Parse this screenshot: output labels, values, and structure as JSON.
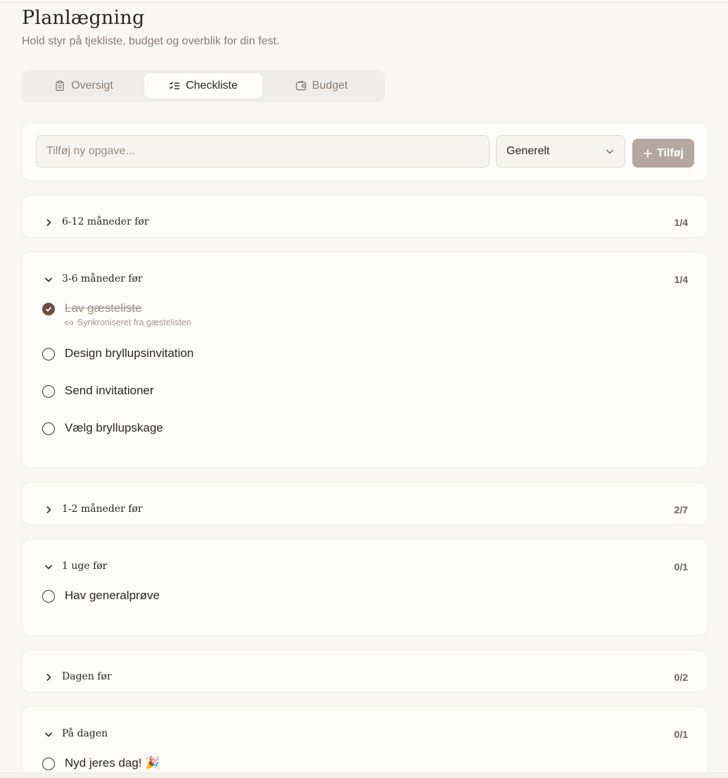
{
  "header": {
    "title": "Planlægning",
    "subtitle": "Hold styr på tjekliste, budget og overblik for din fest."
  },
  "tabs": [
    {
      "label": "Oversigt",
      "icon": "clipboard-icon",
      "active": false
    },
    {
      "label": "Checkliste",
      "icon": "checklist-icon",
      "active": true
    },
    {
      "label": "Budget",
      "icon": "wallet-icon",
      "active": false
    }
  ],
  "add_task": {
    "placeholder": "Tilføj ny opgave...",
    "category_selected": "Generelt",
    "button_label": "Tilføj"
  },
  "sections": [
    {
      "title": "6-12 måneder før",
      "count": "1/4",
      "expanded": false,
      "tasks": []
    },
    {
      "title": "3-6 måneder før",
      "count": "1/4",
      "expanded": true,
      "tasks": [
        {
          "label": "Lav gæsteliste",
          "done": true,
          "note": "Synkroniseret fra gæstelisten"
        },
        {
          "label": "Design bryllupsinvitation",
          "done": false
        },
        {
          "label": "Send invitationer",
          "done": false
        },
        {
          "label": "Vælg bryllupskage",
          "done": false
        }
      ]
    },
    {
      "title": "1-2 måneder før",
      "count": "2/7",
      "expanded": false,
      "tasks": []
    },
    {
      "title": "1 uge før",
      "count": "0/1",
      "expanded": true,
      "tasks": [
        {
          "label": "Hav generalprøve",
          "done": false
        }
      ]
    },
    {
      "title": "Dagen før",
      "count": "0/2",
      "expanded": false,
      "tasks": []
    },
    {
      "title": "På dagen",
      "count": "0/1",
      "expanded": true,
      "tasks": [
        {
          "label": "Nyd jeres dag! 🎉",
          "done": false
        }
      ]
    }
  ],
  "colors": {
    "background": "#f8f7f4",
    "card": "#fefdfb",
    "accent": "#6b4f43",
    "button": "#b5a79e",
    "muted_text": "#8a7d74"
  }
}
